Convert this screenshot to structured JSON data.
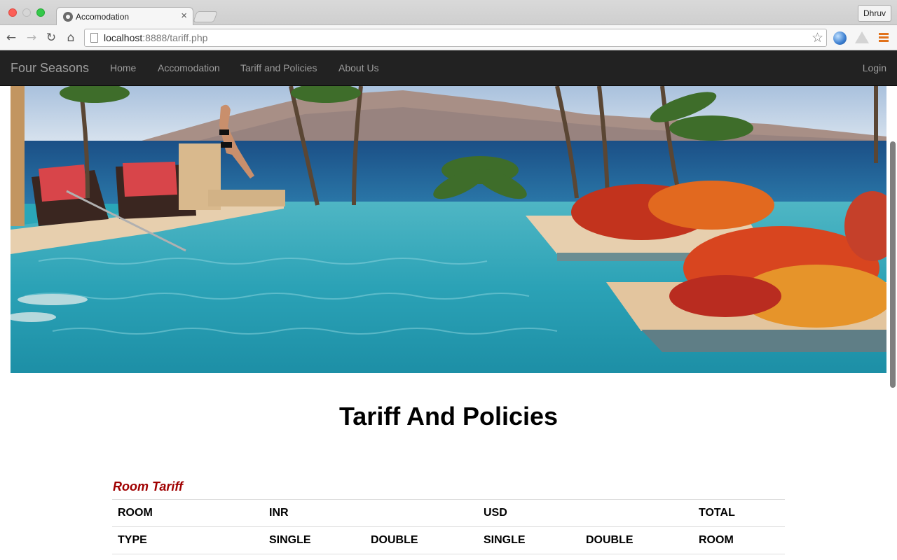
{
  "browser": {
    "tab_title": "Accomodation",
    "tab_close": "×",
    "profile_name": "Dhruv",
    "url_host": "localhost",
    "url_rest": ":8888/tariff.php",
    "back_glyph": "←",
    "forward_glyph": "→",
    "reload_glyph": "↻",
    "home_glyph": "⌂",
    "star_glyph": "☆",
    "icons": [
      "globe-extension-icon",
      "drive-extension-icon",
      "chrome-menu-icon"
    ]
  },
  "navbar": {
    "brand": "Four Seasons",
    "links": [
      "Home",
      "Accomodation",
      "Tariff and Policies",
      "About Us"
    ],
    "login": "Login",
    "background": "#222222",
    "link_color": "#9d9d9d"
  },
  "hero": {
    "description_colors": {
      "sky": "#b7cbe0",
      "sea": "#1f5f98",
      "pool": "#2aa6b8",
      "flowers": "#d8451f"
    }
  },
  "page": {
    "title": "Tariff And Policies",
    "section_title": "Room Tariff",
    "section_color": "#a00000"
  },
  "table": {
    "header_row_1": [
      "ROOM",
      "INR",
      "",
      "USD",
      "",
      "TOTAL"
    ],
    "header_row_2": [
      "TYPE",
      "SINGLE",
      "DOUBLE",
      "SINGLE",
      "DOUBLE",
      "ROOM"
    ]
  }
}
